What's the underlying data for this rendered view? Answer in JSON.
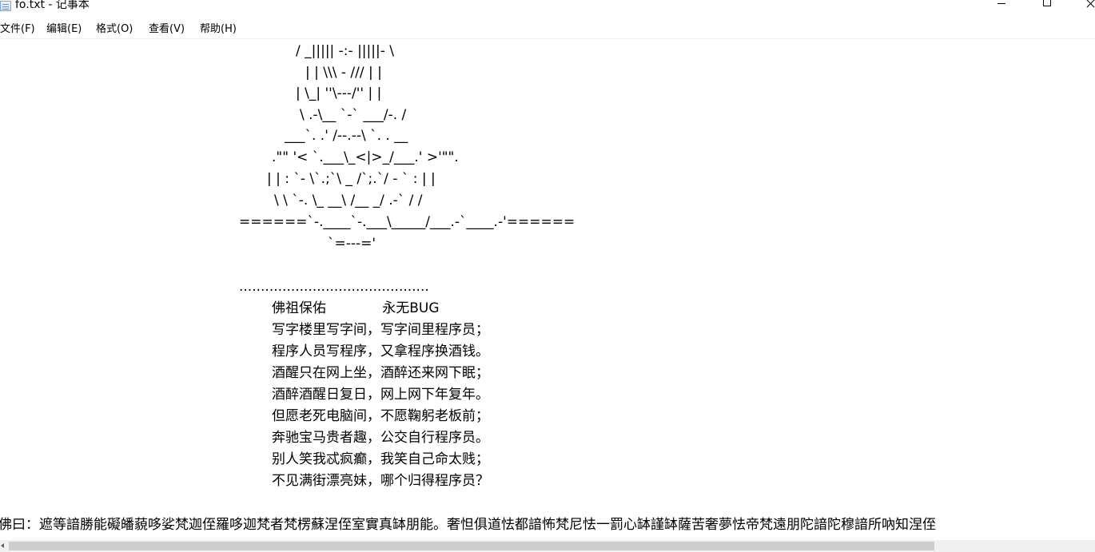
{
  "window": {
    "title": "fo.txt - 记事本"
  },
  "menu": {
    "file": "文件(F)",
    "edit": "编辑(E)",
    "format": "格式(O)",
    "view": "查看(V)",
    "help": "帮助(H)"
  },
  "lines": [
    "/ _||||| -:- |||||- \\",
    "| | \\\\\\ - /// | |",
    "| \\_| ''\\---/'' | |",
    "\\ .-\\__ `-` ___/-. /",
    "___`. .' /--.--\\ `. . __",
    ".\"\" '< `.___\\_<|>_/___.' >'\"\".",
    "| | : `- \\`.;`\\ _ /`;.`/ - ` : | |",
    "\\ \\ `-. \\_ __\\ /__ _/ .-` / /",
    "======`-.____`-.___\\_____/___.-`____.-'======",
    "`=---='",
    "............................................",
    "佛祖保佑             永无BUG",
    "写字楼里写字间，写字间里程序员；",
    "程序人员写程序，又拿程序换酒钱。",
    "酒醒只在网上坐，酒醉还来网下眠；",
    "酒醉酒醒日复日，网上网下年复年。",
    "但愿老死电脑间，不愿鞠躬老板前；",
    "奔驰宝马贵者趣，公交自行程序员。",
    "别人笑我忒疯癫，我笑自己命太贱；",
    "不见满街漂亮妹，哪个归得程序员？",
    "佛曰：遮等諳勝能礙皤藐哆娑梵迦侄羅哆迦梵者梵楞蘇涅侄室實真缽朋能。奢怛俱道怯都諳怖梵尼怯一罰心缽謹缽薩苦奢夢怯帝梵遠朋陀諳陀穆諳所吶知涅侄"
  ]
}
